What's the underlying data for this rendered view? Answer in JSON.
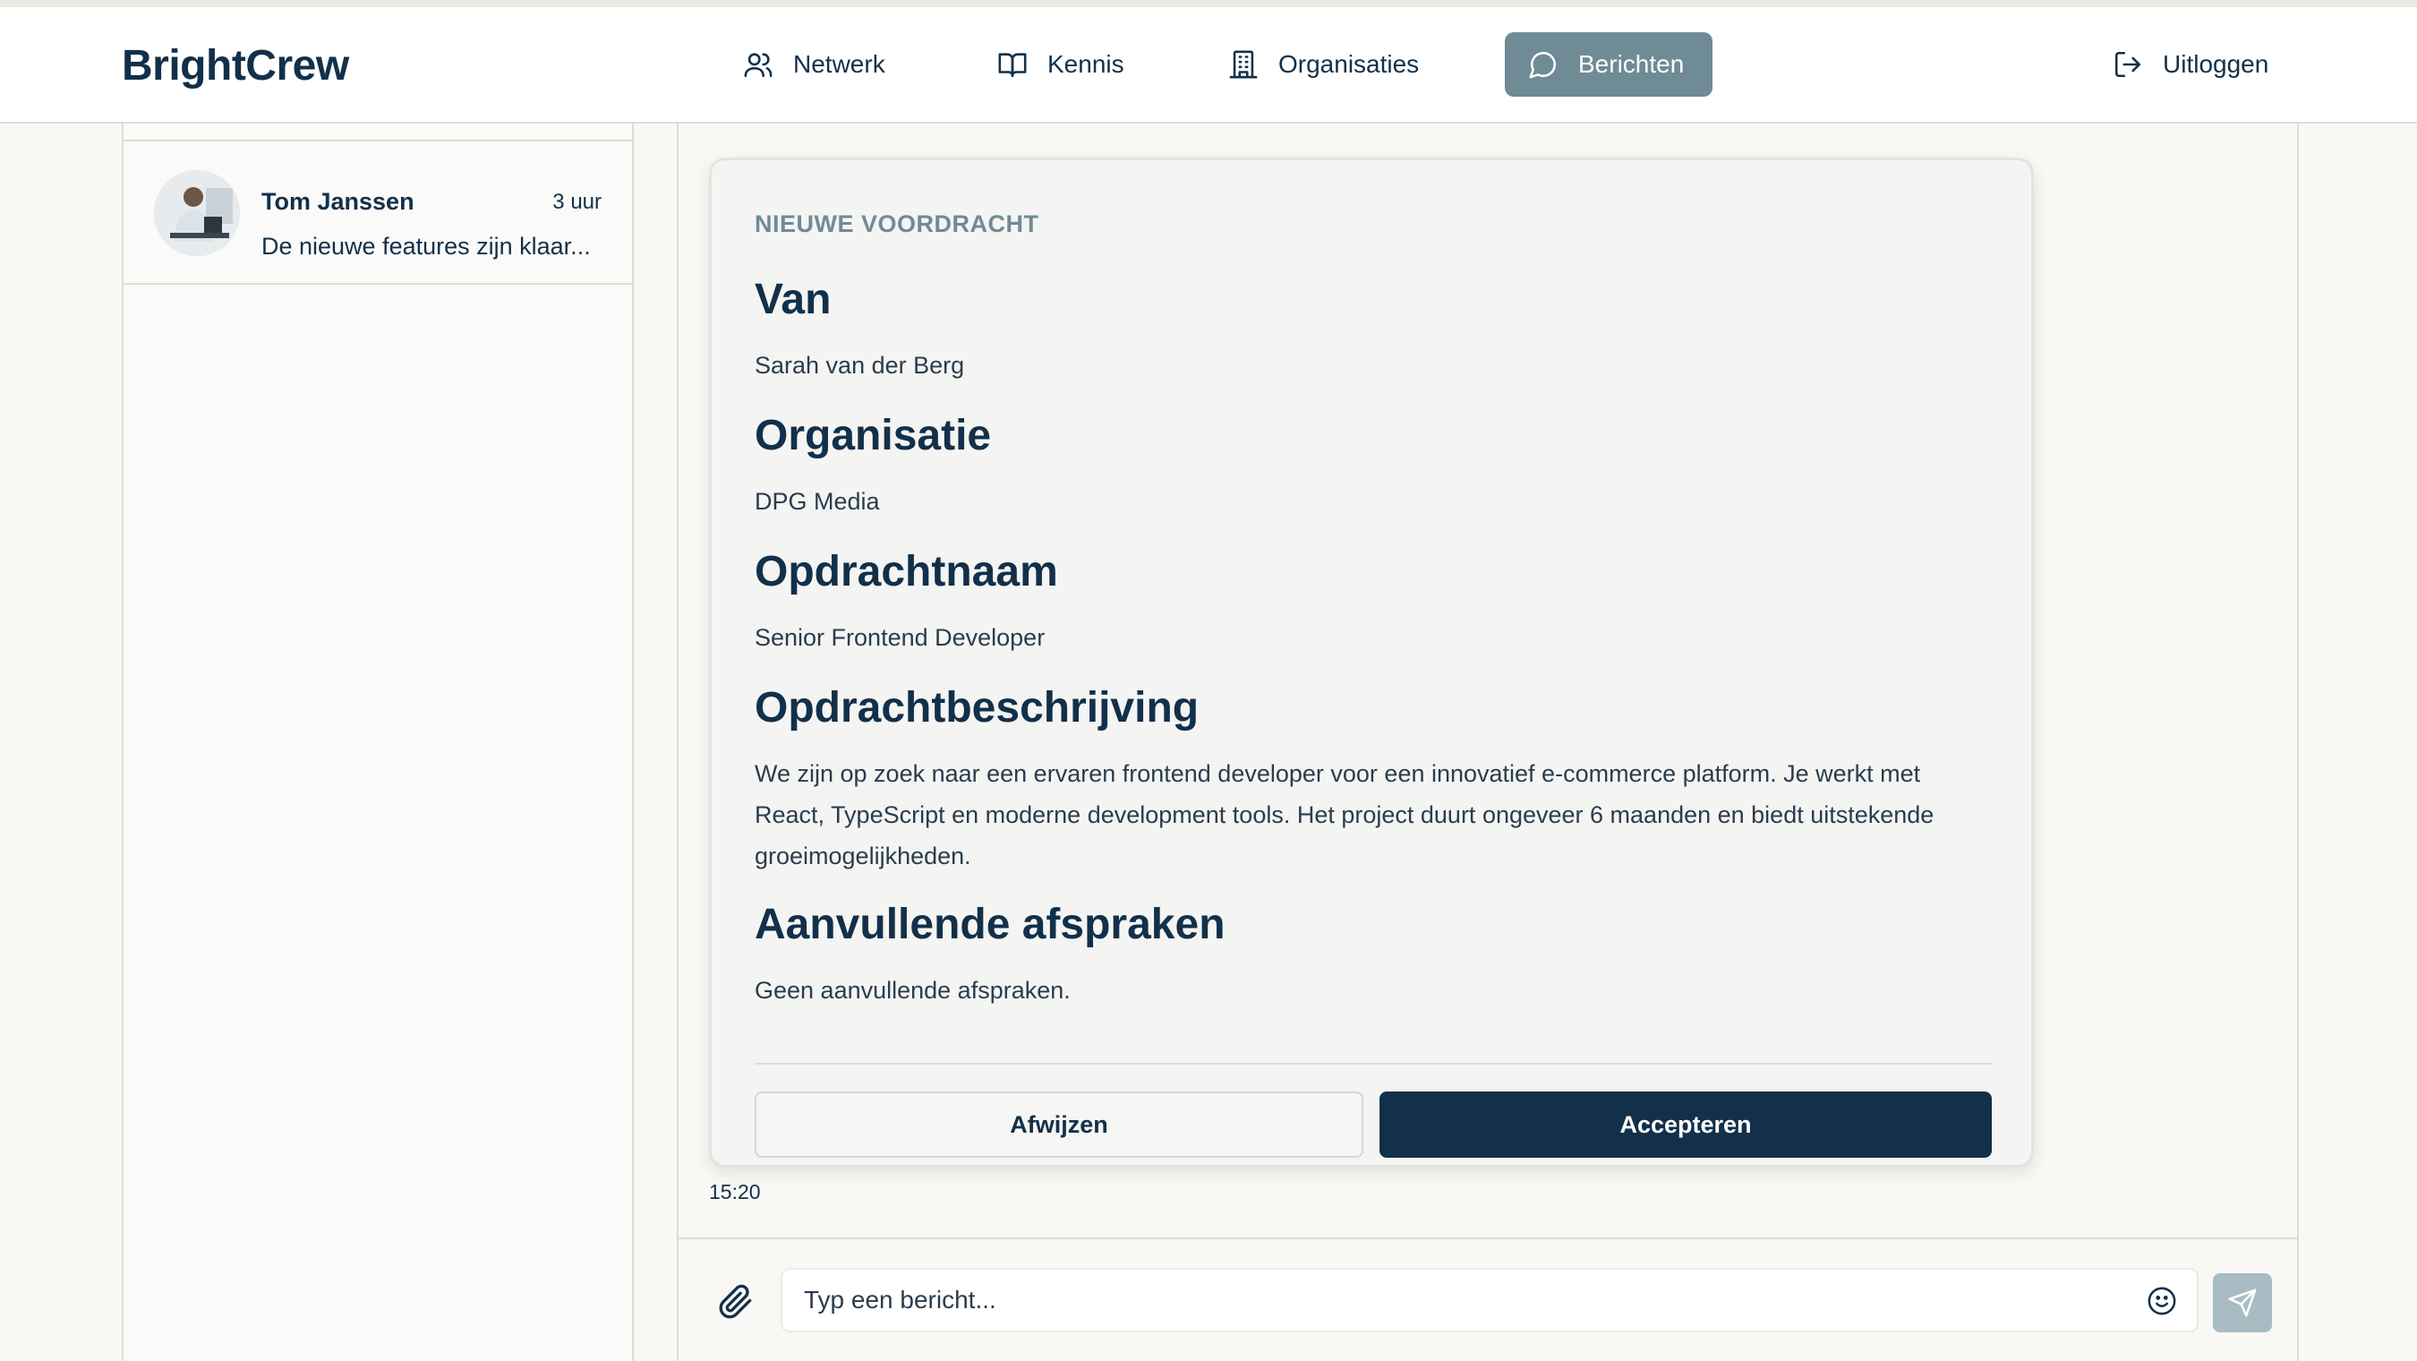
{
  "app": {
    "logo": "BrightCrew"
  },
  "nav": {
    "netwerk": "Netwerk",
    "kennis": "Kennis",
    "organisaties": "Organisaties",
    "berichten": "Berichten",
    "uitloggen": "Uitloggen"
  },
  "conversations": [
    {
      "name": "Tom Janssen",
      "time": "3 uur",
      "preview": "De nieuwe features zijn klaar..."
    }
  ],
  "card": {
    "tag": "NIEUWE VOORDRACHT",
    "fields": [
      {
        "label": "Van",
        "value": "Sarah van der Berg"
      },
      {
        "label": "Organisatie",
        "value": "DPG Media"
      },
      {
        "label": "Opdrachtnaam",
        "value": "Senior Frontend Developer"
      },
      {
        "label": "Opdrachtbeschrijving",
        "value": "We zijn op zoek naar een ervaren frontend developer voor een innovatief e-commerce platform. Je werkt met React, TypeScript en moderne development tools. Het project duurt ongeveer 6 maanden en biedt uitstekende groeimogelijkheden."
      },
      {
        "label": "Aanvullende afspraken",
        "value": "Geen aanvullende afspraken."
      }
    ],
    "reject_label": "Afwijzen",
    "accept_label": "Accepteren"
  },
  "message_time": "15:20",
  "composer": {
    "placeholder": "Typ een bericht..."
  },
  "colors": {
    "primary": "#12304a",
    "nav_active": "#6f8b96",
    "send_disabled": "#a9bcc3"
  }
}
